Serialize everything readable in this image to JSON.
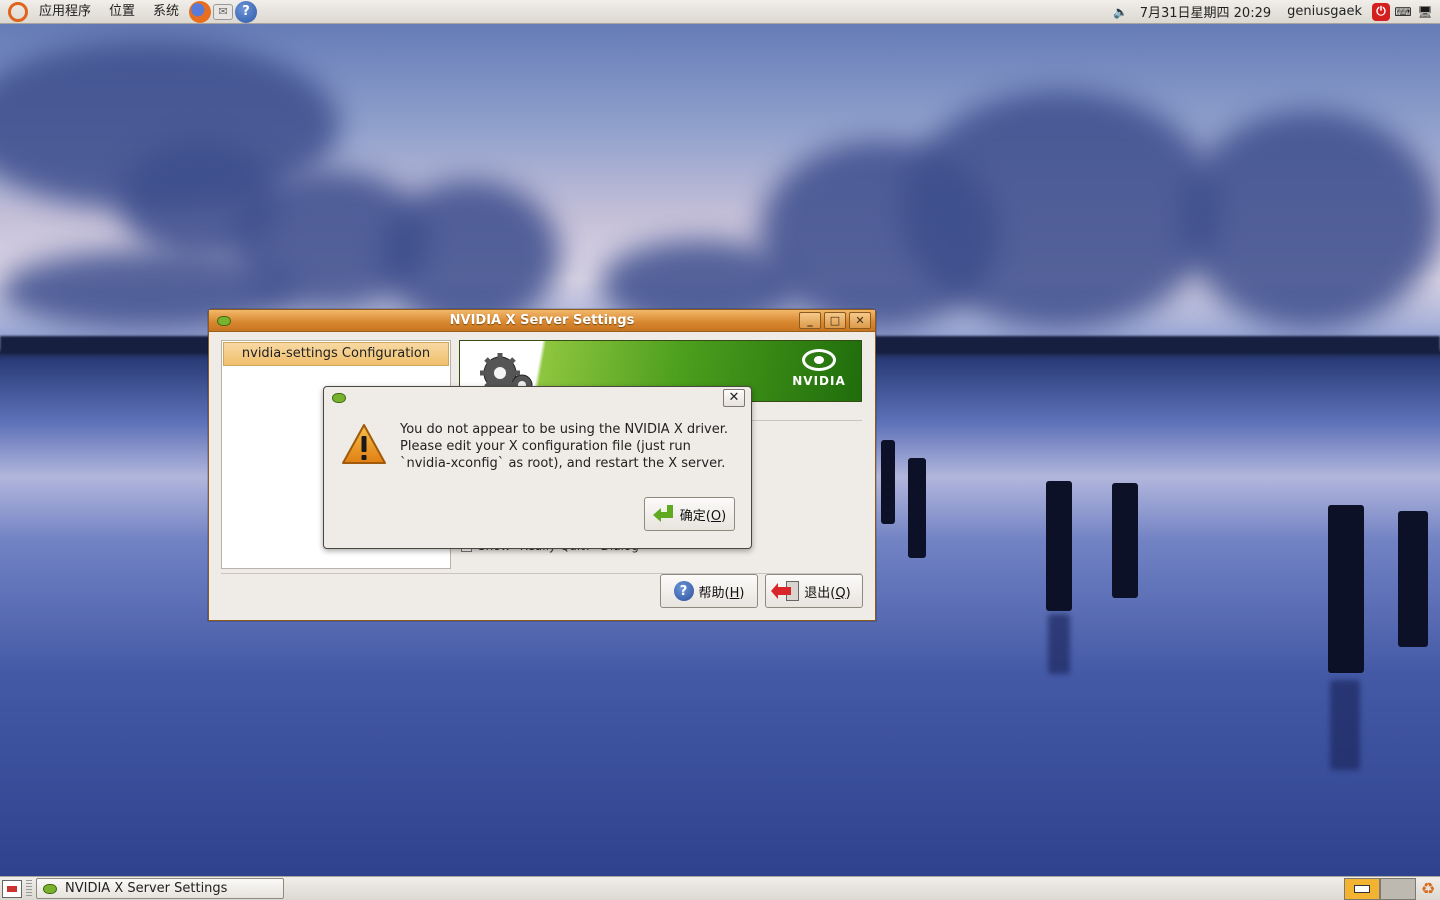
{
  "top_panel": {
    "menus": [
      "应用程序",
      "位置",
      "系统"
    ],
    "launchers": [
      "firefox-icon",
      "mail-icon",
      "help-icon"
    ],
    "datetime": "7月31日星期四  20:29",
    "username": "geniusgaek"
  },
  "window": {
    "title": "NVIDIA X Server Settings",
    "wm_buttons": {
      "minimize": "_",
      "maximize": "□",
      "close": "✕"
    },
    "tree_header": "nvidia-settings Configuration",
    "banner_brand": "NVIDIA",
    "partial_option": "Show \"Really Quit?\" Dialog",
    "help_label": "帮助(",
    "help_mnemonic": "H",
    "quit_label": "退出(",
    "quit_mnemonic": "Q",
    "close_paren": ")"
  },
  "dialog": {
    "close_glyph": "✕",
    "message": "You do not appear to be using the NVIDIA X driver. Please edit your X configuration file (just run `nvidia-xconfig` as root), and restart the X server.",
    "ok_label": "确定(",
    "ok_mnemonic": "O",
    "close_paren": ")"
  },
  "taskbar": {
    "task_title": "NVIDIA X Server Settings",
    "workspaces": 2,
    "active_workspace": 1
  },
  "colors": {
    "title_orange": "#d8862e",
    "nvidia_green": "#76b900",
    "warning_orange": "#f0a030"
  }
}
